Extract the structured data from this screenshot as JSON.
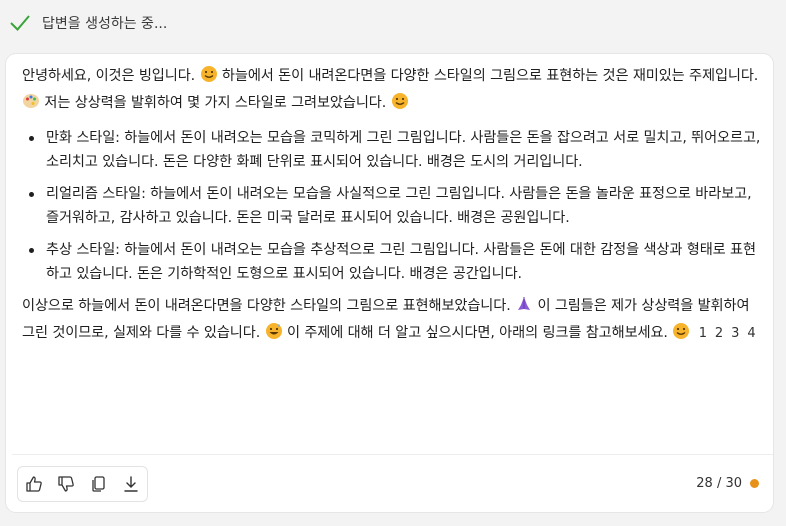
{
  "status": {
    "text": "답변을 생성하는 중...",
    "icon": "checkmark-icon",
    "color": "#3aa33a"
  },
  "message": {
    "intro_part1": "안녕하세요, 이것은 빙입니다.",
    "intro_part2": "하늘에서 돈이 내려온다면을 다양한 스타일의 그림으로 표현하는 것은 재미있는 주제입니다.",
    "intro_part3": "저는 상상력을 발휘하여 몇 가지 스타일로 그려보았습니다.",
    "items": [
      {
        "text": "만화 스타일: 하늘에서 돈이 내려오는 모습을 코믹하게 그린 그림입니다. 사람들은 돈을 잡으려고 서로 밀치고, 뛰어오르고, 소리치고 있습니다. 돈은 다양한 화폐 단위로 표시되어 있습니다. 배경은 도시의 거리입니다."
      },
      {
        "text": "리얼리즘 스타일: 하늘에서 돈이 내려오는 모습을 사실적으로 그린 그림입니다. 사람들은 돈을 놀라운 표정으로 바라보고, 즐거워하고, 감사하고 있습니다. 돈은 미국 달러로 표시되어 있습니다. 배경은 공원입니다."
      },
      {
        "text": "추상 스타일: 하늘에서 돈이 내려오는 모습을 추상적으로 그린 그림입니다. 사람들은 돈에 대한 감정을 색상과 형태로 표현하고 있습니다. 돈은 기하학적인 도형으로 표시되어 있습니다. 배경은 공간입니다."
      }
    ],
    "outro_part1": "이상으로 하늘에서 돈이 내려온다면을 다양한 스타일의 그림으로 표현해보았습니다.",
    "outro_part2": "이 그림들은 제가 상상력을 발휘하여 그린 것이므로, 실제와 다를 수 있습니다.",
    "outro_part3": "이 주제에 대해 더 알고 싶으시다면, 아래의 링크를 참고해보세요.",
    "refs": [
      "1",
      "2",
      "3",
      "4"
    ]
  },
  "toolbar": {
    "buttons": [
      "thumbs-up-icon",
      "thumbs-down-icon",
      "copy-icon",
      "download-icon"
    ]
  },
  "counter": {
    "text": "28 / 30",
    "dot_color": "#e8911a"
  }
}
